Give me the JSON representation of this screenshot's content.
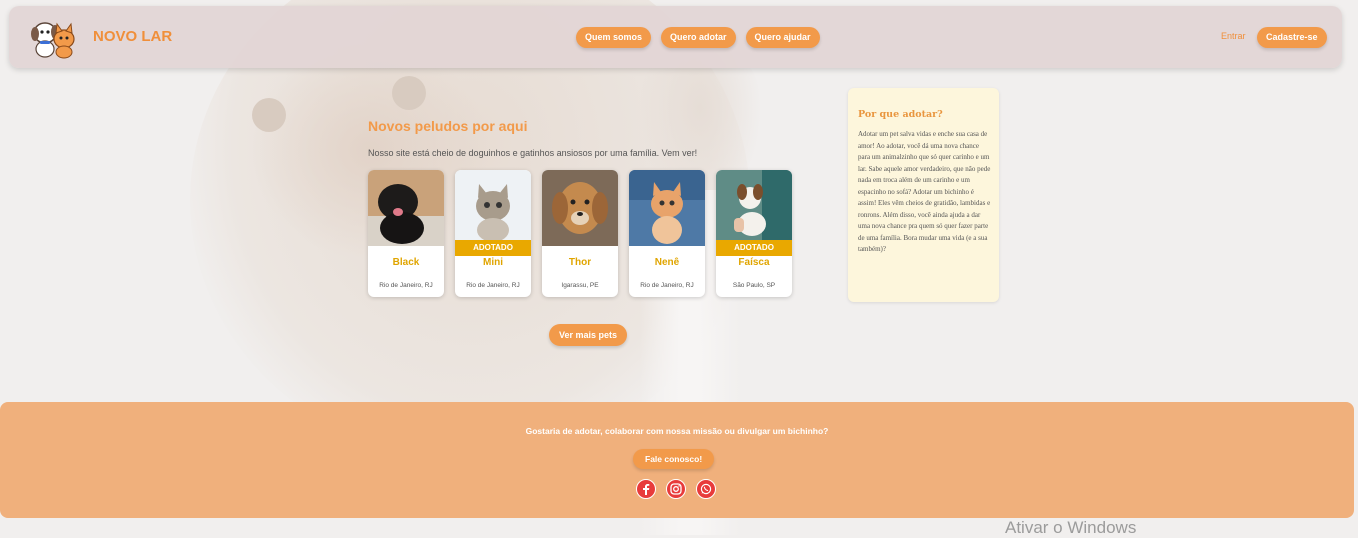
{
  "brand": {
    "name": "NOVO LAR"
  },
  "nav": {
    "items": [
      {
        "label": "Quem somos"
      },
      {
        "label": "Quero adotar"
      },
      {
        "label": "Quero ajudar"
      }
    ],
    "login_label": "Entrar",
    "signup_label": "Cadastre-se"
  },
  "main": {
    "title": "Novos peludos por aqui",
    "subtitle": "Nosso site está cheio de doguinhos e gatinhos ansiosos por uma família. Vem ver!",
    "pets": [
      {
        "name": "Black",
        "location": "Rio de Janeiro, RJ",
        "badge": ""
      },
      {
        "name": "Mini",
        "location": "Rio de Janeiro, RJ",
        "badge": "ADOTADO"
      },
      {
        "name": "Thor",
        "location": "Igarassu, PE",
        "badge": ""
      },
      {
        "name": "Nenê",
        "location": "Rio de Janeiro, RJ",
        "badge": ""
      },
      {
        "name": "Faísca",
        "location": "São Paulo, SP",
        "badge": "ADOTADO"
      }
    ],
    "more_button": "Ver mais pets"
  },
  "aside": {
    "title": "Por que adotar?",
    "text": "Adotar um pet salva vidas e enche sua casa de amor! Ao adotar, você dá uma nova chance para um animalzinho que só quer carinho e um lar. Sabe aquele amor verdadeiro, que não pede nada em troca além de um carinho e um espacinho no sofá? Adotar um bichinho é assim! Eles vêm cheios de gratidão, lambidas e ronrons. Além disso, você ainda ajuda a dar uma nova chance pra quem só quer fazer parte de uma família. Bora mudar uma vida (e a sua também)?"
  },
  "footer": {
    "text": "Gostaria de adotar, colaborar com nossa missão ou divulgar um bichinho?",
    "contact_button": "Fale conosco!",
    "socials": [
      "facebook-icon",
      "instagram-icon",
      "whatsapp-icon"
    ]
  },
  "os_watermark": "Ativar o Windows",
  "colors": {
    "accent": "#f29a4a",
    "badge": "#e9a800",
    "footer": "#f0b07c",
    "aside_bg": "#fdf6dc"
  }
}
